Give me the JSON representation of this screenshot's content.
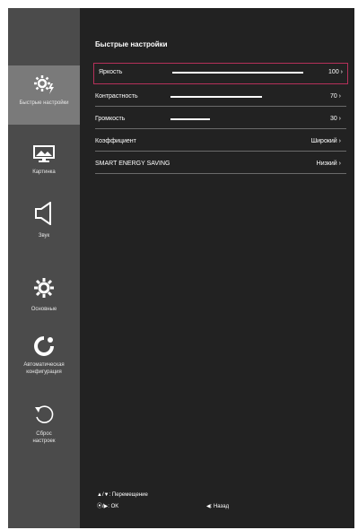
{
  "menu": {
    "title": "Быстрые настройки",
    "rows": [
      {
        "label": "Яркость",
        "value": "100 ›",
        "level": 100
      },
      {
        "label": "Контрастность",
        "value": "70 ›",
        "level": 70
      },
      {
        "label": "Громкость",
        "value": "30 ›",
        "level": 30
      },
      {
        "label": "Коэффициент",
        "value": "Широкий ›"
      },
      {
        "label": "SMART ENERGY SAVING",
        "value": "Низкий ›"
      }
    ]
  },
  "sidebar": {
    "items": [
      {
        "label": "Быстрые настройки",
        "icon": "quick-settings-icon"
      },
      {
        "label": "Картинка",
        "icon": "picture-icon"
      },
      {
        "label": "Звук",
        "icon": "speaker-icon"
      },
      {
        "label": "Основные",
        "icon": "gear-icon"
      },
      {
        "label": "Автоматическая конфигурация",
        "icon": "auto-config-icon"
      },
      {
        "label": "Сброс настроек",
        "icon": "reset-icon"
      }
    ]
  },
  "footer": {
    "move": "▲/▼: Перемещение",
    "ok": "⦿/▶: OK",
    "back": "◀: Назад"
  },
  "colors": {
    "highlight": "#b5305a",
    "panel": "#222222",
    "sidebar": "#4b4b4b"
  }
}
